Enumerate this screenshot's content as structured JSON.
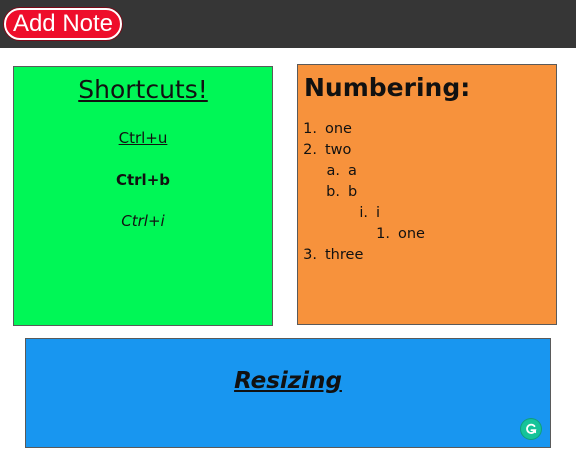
{
  "header": {
    "add_note_label": "Add Note"
  },
  "notes": {
    "shortcuts": {
      "title": "Shortcuts!",
      "lines": [
        "Ctrl+u",
        "Ctrl+b",
        "Ctrl+i"
      ],
      "background": "#00f756"
    },
    "numbering": {
      "title": "Numbering:",
      "background": "#f7923c",
      "items": [
        {
          "marker": "1.",
          "text": "one"
        },
        {
          "marker": "2.",
          "text": "two"
        },
        {
          "marker": "a.",
          "text": "a"
        },
        {
          "marker": "b.",
          "text": "b"
        },
        {
          "marker": "i.",
          "text": "i"
        },
        {
          "marker": "1.",
          "text": "one"
        },
        {
          "marker": "3.",
          "text": "three"
        }
      ]
    },
    "resizing": {
      "title": "Resizing",
      "background": "#1896f0"
    }
  },
  "colors": {
    "topbar": "#363636",
    "add_button": "#ee0d2b",
    "grammarly": "#15c39a"
  },
  "icons": {
    "grammarly": "grammarly-icon"
  }
}
